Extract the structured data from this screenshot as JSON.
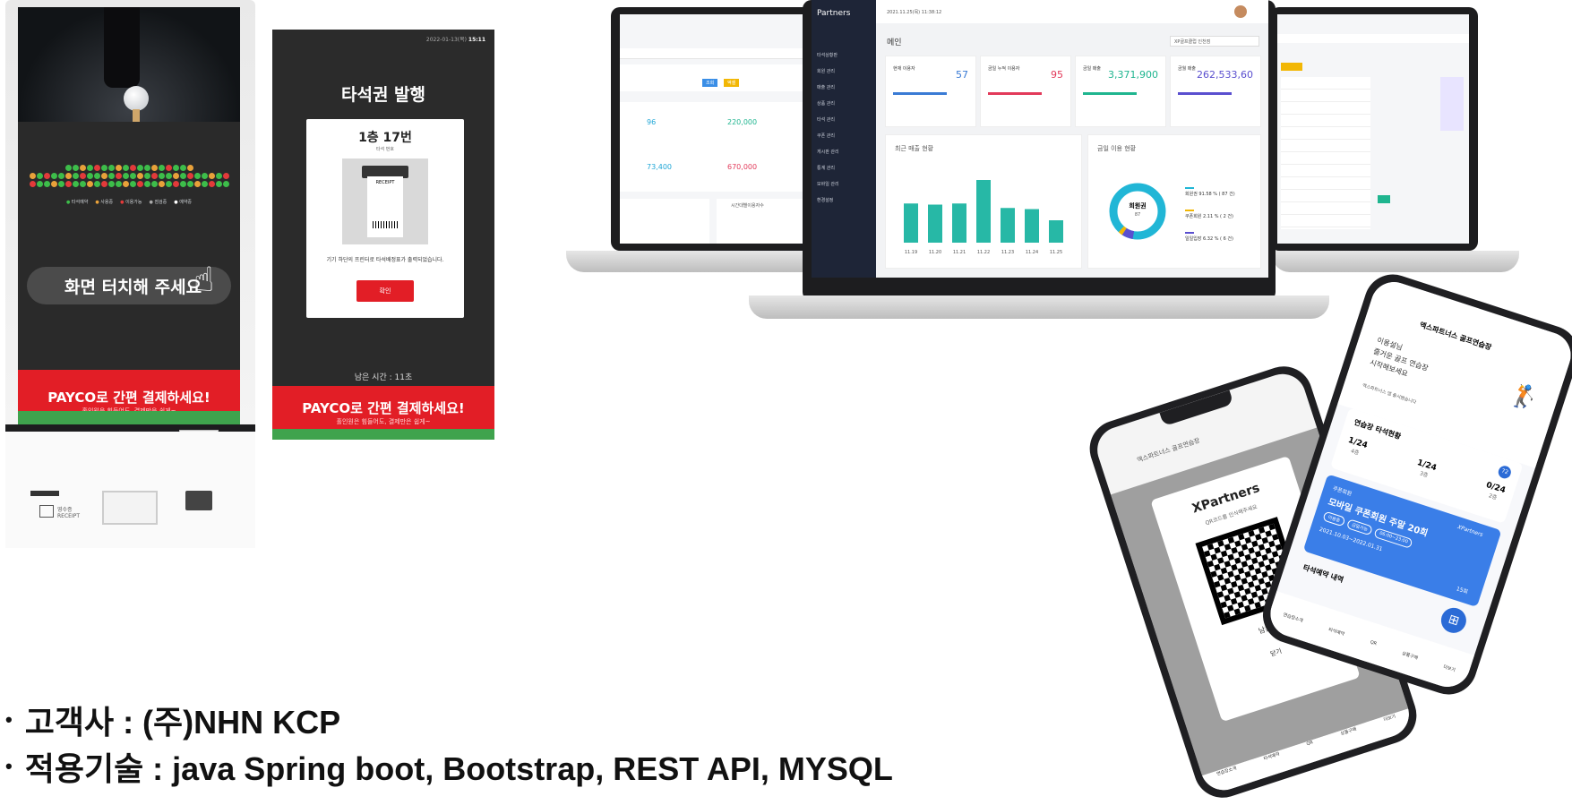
{
  "kiosk": {
    "touch_prompt": "화면 터치해 주세요",
    "payco_headline": "PAYCO로 간편 결제하세요!",
    "payco_sub": "홀인원은 힘들어도, 결제만은 쉽게~",
    "legend": [
      "타석예약",
      "사용중",
      "이용가능",
      "점검중",
      "예약중"
    ],
    "receipt_label": "영수증",
    "receipt_sub": "RECEIPT"
  },
  "ticket_screen": {
    "datetime_prefix": "2022-01-13(목)",
    "datetime_time": "15:11",
    "title": "타석권 발행",
    "seat_number": "1층 17번",
    "seat_caption": "타석 번호",
    "printer_label": "RECEIPT",
    "message": "기기 하단의 프린터로 타석배정표가 출력되었습니다.",
    "confirm_button": "확인",
    "remaining_time": "남은 시간 : 11초",
    "payco_headline": "PAYCO로 간편 결제하세요!",
    "payco_sub": "홀인원은 힘들어도, 결제만은 쉽게~"
  },
  "dashboard": {
    "brand": "Partners",
    "datetime": "2021.11.25(목) 11:38:12",
    "page_title": "메인",
    "store_select": "XP골프클럽 인천점",
    "stats": [
      {
        "label": "현재 이용자",
        "value": "57",
        "color": "#3a7bd5"
      },
      {
        "label": "금일 누적 이용자",
        "value": "95",
        "color": "#e23a5a"
      },
      {
        "label": "금일 매출",
        "value": "3,371,900",
        "color": "#1fb58f"
      },
      {
        "label": "금월 매출",
        "value": "262,533,60",
        "color": "#5a4fcf"
      }
    ],
    "recent_sales_title": "최근 매출 현황",
    "monthly_usage_title": "금일 이용 현황",
    "donut_label": "회원권",
    "donut_value": "87",
    "donut_legend": [
      {
        "label": "회원권 91.58 % ( 87 건)",
        "color": "#21b6d6"
      },
      {
        "label": "쿠폰회원 2.11 % ( 2 건)",
        "color": "#f2b705"
      },
      {
        "label": "일일입장 6.32 % ( 6 건)",
        "color": "#5a4fcf"
      }
    ],
    "sidebar": [
      "타석상황판",
      "회원 관리",
      "매출 관리",
      "상품 관리",
      "타석 관리",
      "쿠폰 관리",
      "게시판 관리",
      "통계 관리",
      "모바일 관리",
      "환경설정"
    ],
    "bar_dates": [
      "11.19",
      "11.20",
      "11.21",
      "11.22",
      "11.23",
      "11.24",
      "11.25"
    ],
    "bar_values": [
      3.5,
      3.4,
      3.5,
      5.6,
      3.1,
      3.0,
      2.0
    ],
    "left_values": [
      "96",
      "220,000",
      "73,400",
      "670,000"
    ],
    "left_buttons": [
      "조회",
      "엑셀"
    ],
    "left_section": "시간대별이용자수"
  },
  "phone_back": {
    "title": "엑스파트너스 골프연습장",
    "brand": "XPartners",
    "qr_caption": "QR코드를 인식해주세요",
    "remaining": "남은시",
    "close": "닫기",
    "nav": [
      "연습장소개",
      "타석예약",
      "QR",
      "상품구매",
      "더보기"
    ]
  },
  "phone_front": {
    "title": "엑스파트너스 골프연습장",
    "greeting_line1": "이용설님",
    "greeting_line2": "즐거운 골프 연습장",
    "greeting_line3": "시작해보세요",
    "notice": "엑스파트너스 앱 출시됐습니다",
    "section_title": "연습장 타석현황",
    "badge": "72",
    "floors": [
      {
        "count": "1/24",
        "floor": "4층"
      },
      {
        "count": "1/24",
        "floor": "3층"
      },
      {
        "count": "0/24",
        "floor": "2층"
      }
    ],
    "coupon_tag": "쿠폰회원",
    "coupon_brand": "XPartners",
    "coupon_title": "모바일 쿠폰회원 주말 20회",
    "coupon_chips": [
      "이용중",
      "금일가능",
      "06:00~23:00"
    ],
    "coupon_period": "2021.10.03~2022.01.31",
    "coupon_count": "15회",
    "reservation_title": "타석예약 내역",
    "nav": [
      "연습장소개",
      "타석예약",
      "QR",
      "상품구매",
      "더보기"
    ]
  },
  "bullets": [
    {
      "label": "고객사 : (주)NHN KCP"
    },
    {
      "label": "적용기술 : java Spring boot, Bootstrap, REST API, MYSQL"
    }
  ]
}
